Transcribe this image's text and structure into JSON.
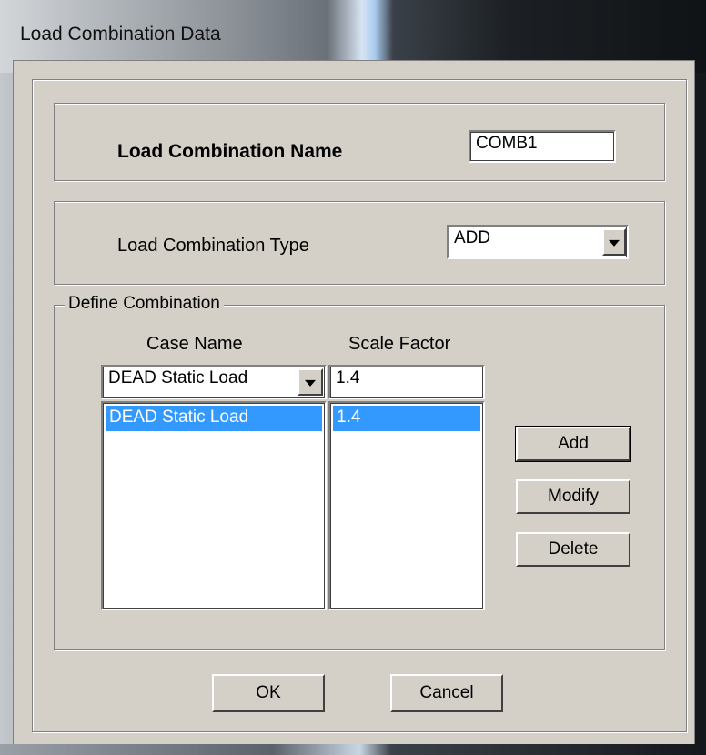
{
  "window": {
    "title": "Load Combination Data"
  },
  "name_section": {
    "label": "Load Combination Name",
    "value": "COMB1"
  },
  "type_section": {
    "label": "Load Combination Type",
    "selected": "ADD"
  },
  "define_combination": {
    "legend": "Define Combination",
    "case_name_header": "Case Name",
    "scale_factor_header": "Scale Factor",
    "case_selected": "DEAD Static Load",
    "scale_value": "1.4",
    "rows": [
      {
        "case_name": "DEAD Static Load",
        "scale_factor": "1.4"
      }
    ],
    "add_label": "Add",
    "modify_label": "Modify",
    "delete_label": "Delete"
  },
  "footer": {
    "ok_label": "OK",
    "cancel_label": "Cancel"
  },
  "colors": {
    "dialog_bg": "#d4d0c8",
    "selection": "#3399ff"
  }
}
